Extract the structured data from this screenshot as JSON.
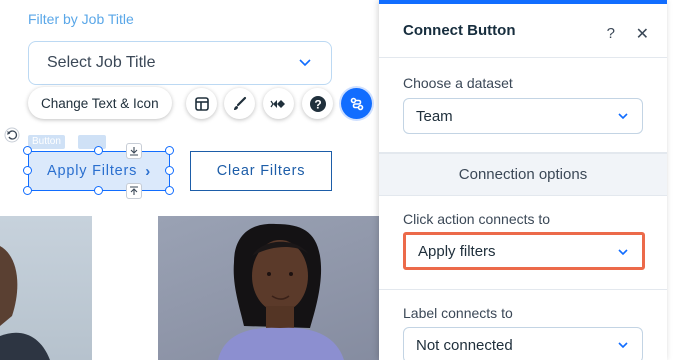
{
  "canvas": {
    "filter_label": "Filter by Job Title",
    "job_select": {
      "placeholder": "Select Job Title"
    },
    "toolbar": {
      "change_text_label": "Change Text & Icon",
      "icons": [
        "layout-icon",
        "paint-brush-icon",
        "animation-icon",
        "help-icon",
        "connect-icon"
      ]
    },
    "element_tag": "Button",
    "apply_button_label": "Apply Filters",
    "clear_button_label": "Clear Filters"
  },
  "panel": {
    "title": "Connect Button",
    "help_label": "?",
    "close_label": "✕",
    "dataset_label": "Choose a dataset",
    "dataset_value": "Team",
    "connection_options_label": "Connection options",
    "click_action_label": "Click action connects to",
    "click_action_value": "Apply filters",
    "label_connects_label": "Label connects to",
    "label_connects_value": "Not connected"
  },
  "colors": {
    "accent": "#116dff",
    "highlight": "#ec6a4a",
    "filter_label": "#5aa7e8"
  }
}
